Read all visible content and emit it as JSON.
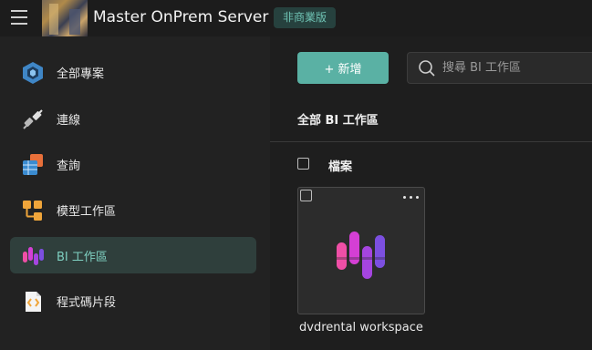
{
  "header": {
    "title": "Master OnPrem Server",
    "license_badge": "非商業版"
  },
  "sidebar": {
    "items": [
      {
        "label": "全部專案",
        "icon": "projects-hexagon-icon",
        "active": false
      },
      {
        "label": "連線",
        "icon": "connection-plug-icon",
        "active": false
      },
      {
        "label": "查詢",
        "icon": "query-table-icon",
        "active": false
      },
      {
        "label": "模型工作區",
        "icon": "model-workspace-icon",
        "active": false
      },
      {
        "label": "BI 工作區",
        "icon": "bi-workspace-icon",
        "active": true
      },
      {
        "label": "程式碼片段",
        "icon": "code-snippet-icon",
        "active": false
      }
    ]
  },
  "toolbar": {
    "new_label": "+ 新增",
    "search_placeholder": "搜尋 BI 工作區"
  },
  "main": {
    "heading": "全部 BI 工作區",
    "files_header": "檔案",
    "cards": [
      {
        "title": "dvdrental workspace"
      }
    ]
  },
  "colors": {
    "accent": "#5ab1a4",
    "active_nav_bg": "#2f3f3c",
    "badge_text": "#6fc3b4"
  }
}
